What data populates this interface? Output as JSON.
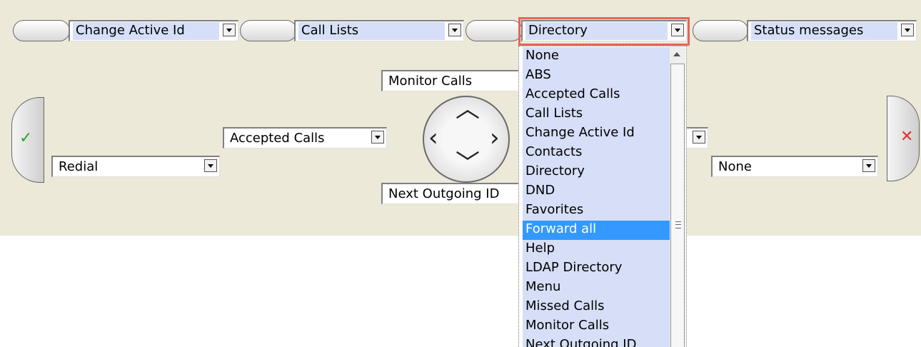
{
  "top_bar": {
    "selects": [
      {
        "label": "Change Active Id"
      },
      {
        "label": "Call Lists"
      },
      {
        "label": "Directory"
      },
      {
        "label": "Status messages"
      }
    ]
  },
  "softkeys": {
    "left_select": "Redial",
    "accepted_select": "Accepted Calls",
    "monitor_select": "Monitor Calls",
    "next_outgoing_select": "Next Outgoing ID",
    "right_select": "None"
  },
  "dropdown": {
    "highlighted": "Forward all",
    "options": [
      "None",
      "ABS",
      "Accepted Calls",
      "Call Lists",
      "Change Active Id",
      "Contacts",
      "Directory",
      "DND",
      "Favorites",
      "Forward all",
      "Help",
      "LDAP Directory",
      "Menu",
      "Missed Calls",
      "Monitor Calls",
      "Next Outgoing ID"
    ]
  },
  "icons": {
    "accept": "check-icon",
    "reject": "x-icon",
    "colors": {
      "accept": "#2aa52a",
      "reject": "#e03030",
      "highlight": "#3399ff",
      "field_blue": "#d6dff7"
    }
  }
}
